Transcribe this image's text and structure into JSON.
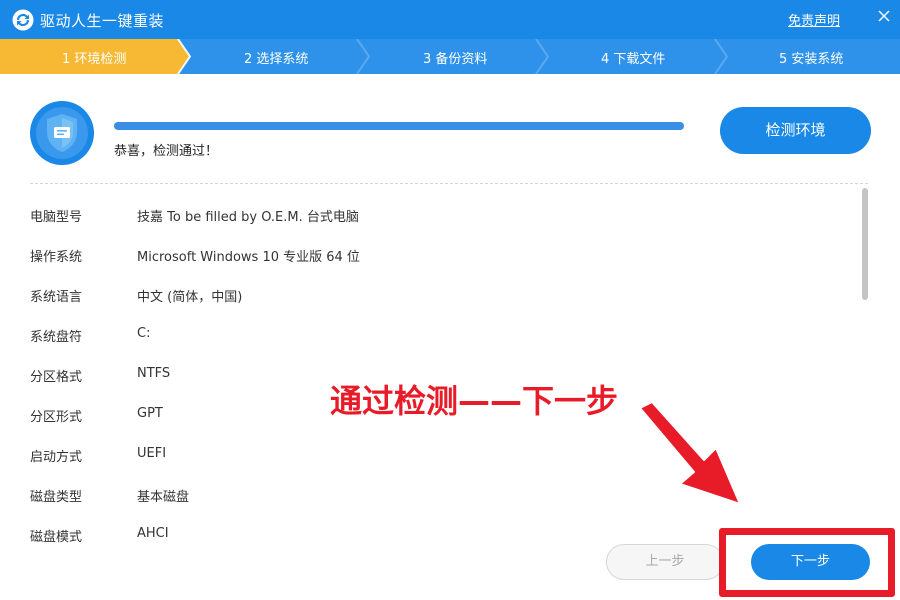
{
  "window": {
    "title": "驱动人生一键重装",
    "disclaimer": "免责声明",
    "close_glyph": "✕"
  },
  "steps": [
    {
      "label": "1 环境检测",
      "active": true
    },
    {
      "label": "2 选择系统",
      "active": false
    },
    {
      "label": "3 备份资料",
      "active": false
    },
    {
      "label": "4 下载文件",
      "active": false
    },
    {
      "label": "5 安装系统",
      "active": false
    }
  ],
  "detection": {
    "progress": 1.0,
    "status": "恭喜，检测通过！",
    "button": "检测环境"
  },
  "info": [
    {
      "key": "电脑型号",
      "value": "技嘉 To be filled by O.E.M. 台式电脑"
    },
    {
      "key": "操作系统",
      "value": "Microsoft Windows 10 专业版 64 位"
    },
    {
      "key": "系统语言",
      "value": "中文 (简体，中国)"
    },
    {
      "key": "系统盘符",
      "value": "C:"
    },
    {
      "key": "分区格式",
      "value": "NTFS"
    },
    {
      "key": "分区形式",
      "value": "GPT"
    },
    {
      "key": "启动方式",
      "value": "UEFI"
    },
    {
      "key": "磁盘类型",
      "value": "基本磁盘"
    },
    {
      "key": "磁盘模式",
      "value": "AHCI"
    }
  ],
  "annotation": {
    "text": "通过检测——下一步"
  },
  "footer": {
    "prev": "上一步",
    "next": "下一步"
  },
  "colors": {
    "primary": "#1a88e6",
    "active_step": "#f7b934",
    "annotation": "#e81b28"
  }
}
